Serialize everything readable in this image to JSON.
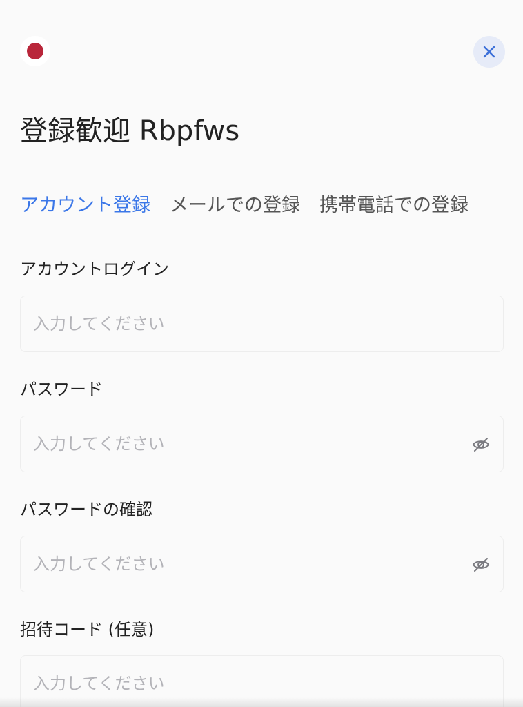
{
  "header": {
    "flag_icon": "japan-flag-icon",
    "flag_color": "#b9263a",
    "close_icon": "close-icon",
    "accent_color": "#3b77e8"
  },
  "title": "登録歓迎 Rbpfws",
  "tabs": [
    {
      "label": "アカウント登録",
      "active": true
    },
    {
      "label": "メールでの登録",
      "active": false
    },
    {
      "label": "携帯電話での登録",
      "active": false
    }
  ],
  "form": {
    "account": {
      "label": "アカウントログイン",
      "placeholder": "入力してください",
      "value": ""
    },
    "password": {
      "label": "パスワード",
      "placeholder": "入力してください",
      "value": "",
      "icon": "eye-off-icon"
    },
    "password_confirm": {
      "label": "パスワードの確認",
      "placeholder": "入力してください",
      "value": "",
      "icon": "eye-off-icon"
    },
    "invite_code": {
      "label": "招待コード (任意)",
      "placeholder": "入力してください",
      "value": ""
    }
  }
}
